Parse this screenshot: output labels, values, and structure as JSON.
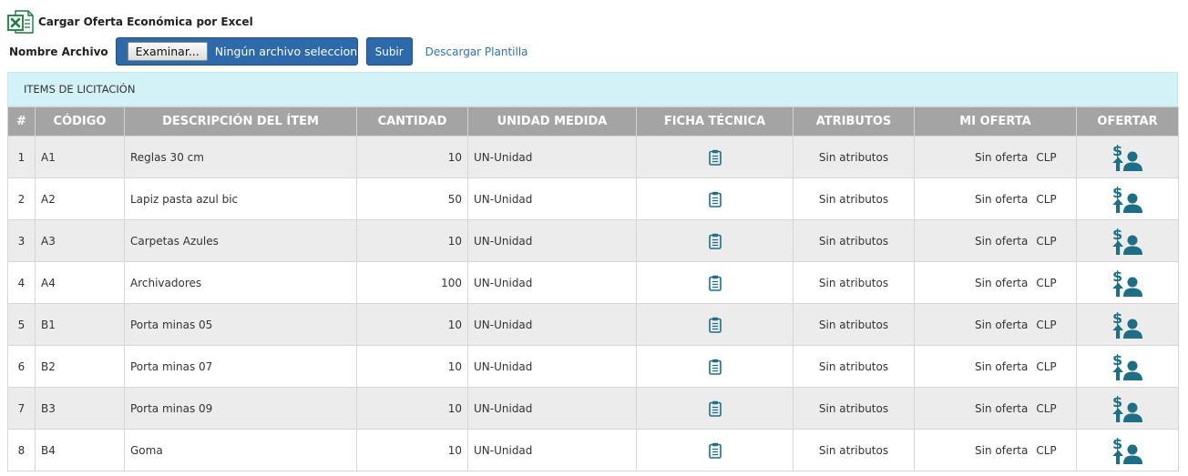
{
  "header": {
    "title": "Cargar Oferta Económica por Excel",
    "file_label": "Nombre Archivo",
    "browse_label": "Examinar...",
    "no_file_text": "Ningún archivo seleccionado.",
    "upload_label": "Subir",
    "template_link": "Descargar Plantilla"
  },
  "panel": {
    "title": "ITEMS DE LICITACIÓN"
  },
  "colors": {
    "primary": "#2e6aa9",
    "panel_bg": "#d3f2f8",
    "header_bg": "#a4a4a4",
    "icon": "#1e6f86"
  },
  "table": {
    "columns": [
      "#",
      "CÓDIGO",
      "DESCRIPCIÓN DEL ÍTEM",
      "CANTIDAD",
      "UNIDAD MEDIDA",
      "FICHA TÉCNICA",
      "ATRIBUTOS",
      "MI OFERTA",
      "OFERTAR"
    ],
    "rows": [
      {
        "n": "1",
        "code": "A1",
        "desc": "Reglas 30 cm",
        "qty": "10",
        "unit": "UN-Unidad",
        "attrs": "Sin atributos",
        "offer": "Sin oferta",
        "currency": "CLP"
      },
      {
        "n": "2",
        "code": "A2",
        "desc": "Lapiz pasta azul bic",
        "qty": "50",
        "unit": "UN-Unidad",
        "attrs": "Sin atributos",
        "offer": "Sin oferta",
        "currency": "CLP"
      },
      {
        "n": "3",
        "code": "A3",
        "desc": "Carpetas Azules",
        "qty": "10",
        "unit": "UN-Unidad",
        "attrs": "Sin atributos",
        "offer": "Sin oferta",
        "currency": "CLP"
      },
      {
        "n": "4",
        "code": "A4",
        "desc": "Archivadores",
        "qty": "100",
        "unit": "UN-Unidad",
        "attrs": "Sin atributos",
        "offer": "Sin oferta",
        "currency": "CLP"
      },
      {
        "n": "5",
        "code": "B1",
        "desc": "Porta minas 05",
        "qty": "10",
        "unit": "UN-Unidad",
        "attrs": "Sin atributos",
        "offer": "Sin oferta",
        "currency": "CLP"
      },
      {
        "n": "6",
        "code": "B2",
        "desc": "Porta minas 07",
        "qty": "10",
        "unit": "UN-Unidad",
        "attrs": "Sin atributos",
        "offer": "Sin oferta",
        "currency": "CLP"
      },
      {
        "n": "7",
        "code": "B3",
        "desc": "Porta minas 09",
        "qty": "10",
        "unit": "UN-Unidad",
        "attrs": "Sin atributos",
        "offer": "Sin oferta",
        "currency": "CLP"
      },
      {
        "n": "8",
        "code": "B4",
        "desc": "Goma",
        "qty": "10",
        "unit": "UN-Unidad",
        "attrs": "Sin atributos",
        "offer": "Sin oferta",
        "currency": "CLP"
      }
    ]
  }
}
